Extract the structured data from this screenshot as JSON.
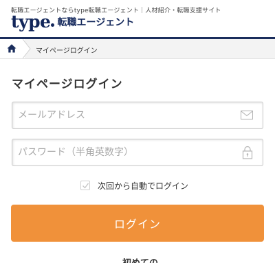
{
  "header": {
    "tagline": "転職エージェントならtype転職エージェント｜人材紹介・転職支援サイト",
    "logo_text": "type",
    "logo_subtitle": "転職エージェント",
    "brand_color": "#12265a"
  },
  "breadcrumb": {
    "home_icon": "home-icon",
    "current": "マイページログイン"
  },
  "page": {
    "title": "マイページログイン"
  },
  "form": {
    "email": {
      "value": "",
      "placeholder": "メールアドレス",
      "icon": "mail-icon"
    },
    "password": {
      "value": "",
      "placeholder": "パスワード（半角英数字）",
      "icon": "lock-icon"
    },
    "remember": {
      "label": "次回から自動でログイン",
      "checked": true
    },
    "submit_label": "ログイン",
    "accent_color": "#f0913a"
  },
  "footer_cutoff": {
    "text": "初めての"
  }
}
